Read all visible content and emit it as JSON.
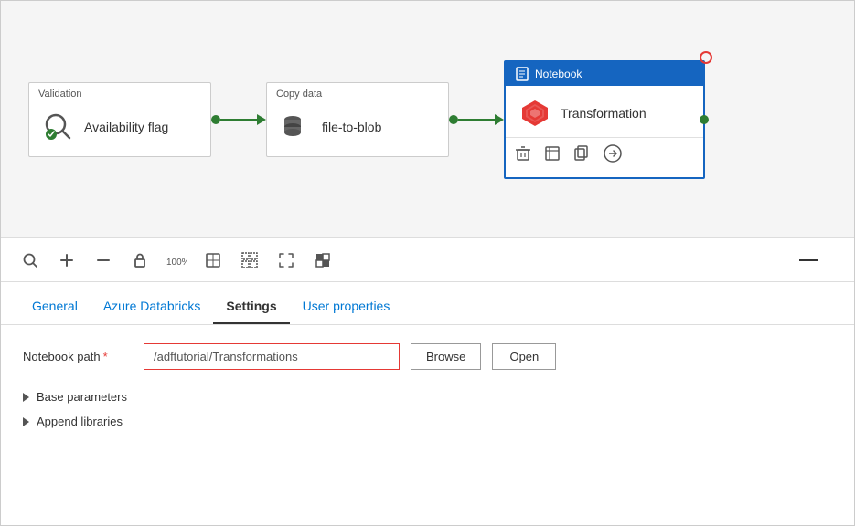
{
  "canvas": {
    "nodes": [
      {
        "id": "validation",
        "title": "Validation",
        "label": "Availability flag",
        "icon": "validation"
      },
      {
        "id": "copy-data",
        "title": "Copy data",
        "label": "file-to-blob",
        "icon": "copy"
      },
      {
        "id": "notebook",
        "title": "Notebook",
        "label": "Transformation",
        "icon": "databricks"
      }
    ],
    "notebook_actions": [
      "delete",
      "view",
      "copy",
      "arrow-right"
    ]
  },
  "toolbar": {
    "icons": [
      "search",
      "plus",
      "minus",
      "lock",
      "percent-100",
      "fit-page",
      "select",
      "resize",
      "layers"
    ]
  },
  "tabs": [
    {
      "id": "general",
      "label": "General",
      "active": false
    },
    {
      "id": "azure-databricks",
      "label": "Azure Databricks",
      "active": false
    },
    {
      "id": "settings",
      "label": "Settings",
      "active": true
    },
    {
      "id": "user-properties",
      "label": "User properties",
      "active": false
    }
  ],
  "settings": {
    "notebook_path_label": "Notebook path",
    "notebook_path_required": "*",
    "notebook_path_value": "/adftutorial/Transformations",
    "browse_label": "Browse",
    "open_label": "Open",
    "base_parameters_label": "Base parameters",
    "append_libraries_label": "Append libraries"
  }
}
